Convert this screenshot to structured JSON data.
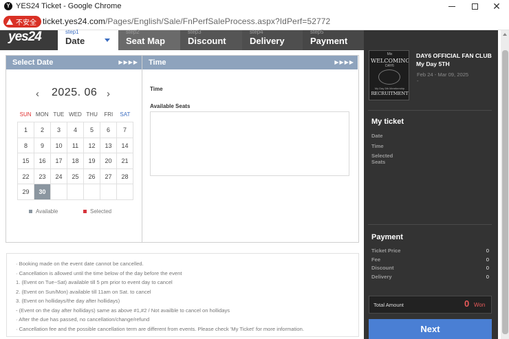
{
  "window": {
    "favicon": "Y",
    "title": "YES24 Ticket - Google Chrome",
    "security_label": "不安全",
    "url_host": "ticket.yes24.com",
    "url_path": "/Pages/English/Sale/FnPerfSaleProcess.aspx?IdPerf=52772"
  },
  "header": {
    "logo": "yes24",
    "steps": [
      {
        "no": "step1",
        "label": "Date"
      },
      {
        "no": "step2",
        "label": "Seat Map"
      },
      {
        "no": "step3",
        "label": "Discount"
      },
      {
        "no": "step4",
        "label": "Delivery"
      },
      {
        "no": "step5",
        "label": "Payment"
      }
    ],
    "panel_arrows": "▶▶▶▶"
  },
  "date_panel": {
    "title": "Select Date",
    "month": "2025. 06",
    "prev": "‹",
    "next": "›",
    "weekdays": [
      "SUN",
      "MON",
      "TUE",
      "WED",
      "THU",
      "FRI",
      "SAT"
    ],
    "days": [
      "1",
      "2",
      "3",
      "4",
      "5",
      "6",
      "7",
      "8",
      "9",
      "10",
      "11",
      "12",
      "13",
      "14",
      "15",
      "16",
      "17",
      "18",
      "19",
      "20",
      "21",
      "22",
      "23",
      "24",
      "25",
      "26",
      "27",
      "28",
      "29",
      "30",
      "",
      "",
      "",
      "",
      ""
    ],
    "selected_day": "30",
    "legend_available": "Available",
    "legend_selected": "Selected",
    "colors": {
      "available": "#8b96a0",
      "selected": "#d6333b",
      "header": "#8ea3bd"
    }
  },
  "time_panel": {
    "title": "Time",
    "time_label": "Time",
    "seats_label": "Available Seats"
  },
  "notices": [
    "· Booking made on the event date cannot be cancelled.",
    "· Cancellation is allowed until the time below of the day before the event",
    " 1. (Event on Tue~Sat) available till 5 pm prior to event day to cancel",
    " 2. (Event on Sun/Mon) available till 11am on Sat. to cancel",
    " 3. (Event on hollidays/the day after hollidays)",
    " - (Event on the day after hollidays) same as above #1,#2 / Not availble to cancel on hollidays",
    "· After the due has passed, no cancellation/change/refund",
    "· Cancellation fee and the possible cancellation term are different from events. Please check 'My Ticket' for more information."
  ],
  "sidebar": {
    "poster": {
      "line1": "Mix",
      "line2": "WELCOMING",
      "line3": "DAY6",
      "line4": "My Day 5th Membership",
      "line5": "RECRUITMENT"
    },
    "event_title": "DAY6 OFFICIAL FAN CLUB My Day 5TH",
    "event_period": "Feb 24 - Mar 09, 2025",
    "event_dash": "-",
    "my_ticket": {
      "title": "My ticket",
      "date_label": "Date",
      "time_label": "Time",
      "seats_label": "Selected Seats"
    },
    "payment": {
      "title": "Payment",
      "rows": [
        {
          "label": "Ticket Price",
          "value": "0"
        },
        {
          "label": "Fee",
          "value": "0"
        },
        {
          "label": "Discount",
          "value": "0"
        },
        {
          "label": "Delivery",
          "value": "0"
        }
      ],
      "total_label": "Total Amount",
      "total_value": "0",
      "total_unit": "Won"
    },
    "next_label": "Next",
    "colors": {
      "background": "#333333",
      "next": "#4a7fd4",
      "total": "#e85a5a"
    }
  }
}
